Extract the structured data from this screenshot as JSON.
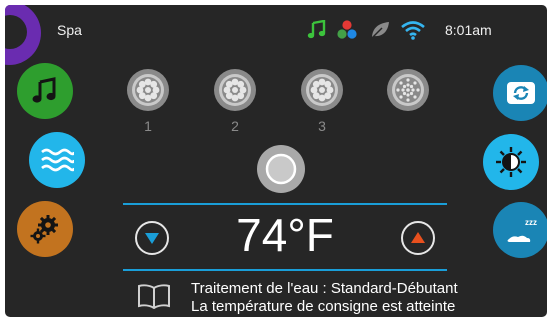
{
  "header": {
    "title": "Spa",
    "time": "8:01am"
  },
  "status_icons": [
    {
      "name": "music-note-icon",
      "color": "#3cc33c"
    },
    {
      "name": "color-light-icon",
      "colors": [
        "#e53935",
        "#43a047",
        "#1e88e5"
      ]
    },
    {
      "name": "leaf-icon",
      "color": "#8a8a8a"
    },
    {
      "name": "wifi-icon",
      "color": "#35b5f0"
    }
  ],
  "left_buttons": [
    {
      "name": "audio-button",
      "icon": "music-note-icon",
      "color": "#2e9e2e"
    },
    {
      "name": "water-care-button",
      "icon": "waves-icon",
      "color": "#22b6ea"
    },
    {
      "name": "settings-button",
      "icon": "gears-icon",
      "color": "#c2731f"
    }
  ],
  "right_buttons": [
    {
      "name": "refresh-button",
      "icon": "refresh-icon",
      "color": "#1a85b5"
    },
    {
      "name": "light-button",
      "icon": "sun-icon",
      "color": "#22b6ea"
    },
    {
      "name": "sleep-button",
      "icon": "sleep-icon",
      "color": "#1a85b5"
    }
  ],
  "pumps": [
    {
      "label": "1"
    },
    {
      "label": "2"
    },
    {
      "label": "3"
    },
    {
      "label": ""
    }
  ],
  "temperature": {
    "value": "74°F"
  },
  "messages": {
    "line1": "Traitement de l'eau : Standard-Débutant",
    "line2": "La température de consigne est atteinte"
  },
  "colors": {
    "background": "#262626",
    "accent_blue": "#1a9ed8",
    "orange_arrow": "#e8501e"
  }
}
